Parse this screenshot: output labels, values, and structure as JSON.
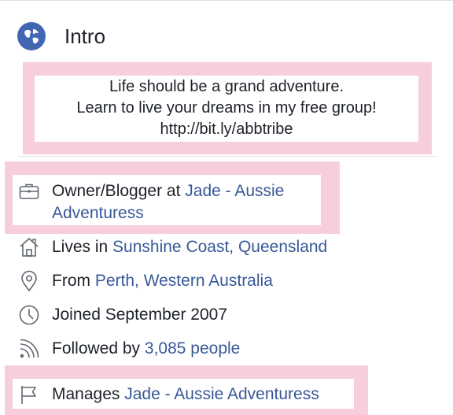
{
  "header": {
    "title": "Intro",
    "icon": "globe-icon"
  },
  "bio": {
    "lines": [
      "Life should be a grand adventure.",
      "Learn to live your dreams in my free group!",
      "http://bit.ly/abbtribe"
    ]
  },
  "details": {
    "work": {
      "icon": "briefcase-icon",
      "prefix": "Owner/Blogger at ",
      "link_line1": "Jade - Aussie",
      "link_line2": "Adventuress"
    },
    "lives": {
      "icon": "home-icon",
      "prefix": "Lives in ",
      "link": "Sunshine Coast, Queensland"
    },
    "from": {
      "icon": "location-pin-icon",
      "prefix": "From ",
      "link": "Perth, Western Australia"
    },
    "joined": {
      "icon": "clock-icon",
      "text": "Joined September 2007"
    },
    "followed": {
      "icon": "rss-icon",
      "prefix": "Followed by ",
      "link": "3,085 people"
    },
    "manages": {
      "icon": "flag-icon",
      "prefix": "Manages ",
      "link": "Jade - Aussie Adventuress"
    }
  },
  "colors": {
    "link": "#385898",
    "highlight": "#f7cfdc",
    "globe": "#4267b2",
    "icon_gray": "#606770"
  }
}
